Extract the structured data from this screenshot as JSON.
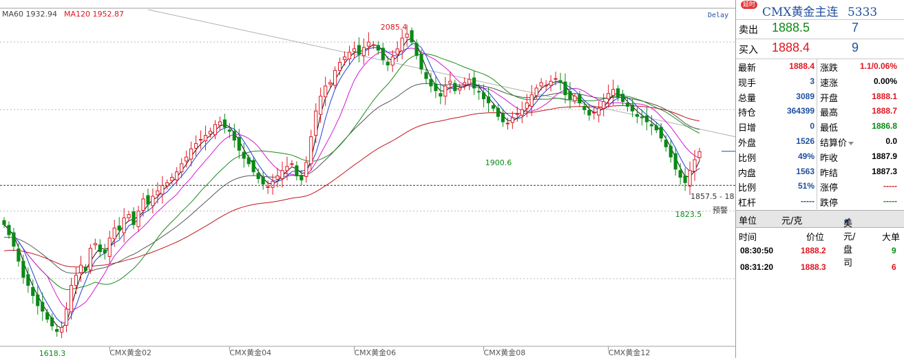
{
  "chart_data": {
    "type": "candlestick",
    "instrument": "CMX黄金主连",
    "delay_label": "Delay",
    "ma_legend": [
      {
        "name": "MA60",
        "value": "1932.94",
        "color": "#444444"
      },
      {
        "name": "MA120",
        "value": "1952.87",
        "color": "#e0141e"
      }
    ],
    "x_tick_labels": [
      "CMX黄金02",
      "CMX黄金04",
      "CMX黄金06",
      "CMX黄金08",
      "CMX黄金12"
    ],
    "annotations": {
      "high": "2085.4",
      "low": "1618.3",
      "mid_low": "1900.6",
      "recent_low": "1823.5",
      "range": "1857.5 - 18",
      "warning": "预警"
    },
    "ylim": [
      1600,
      2100
    ],
    "warning_level": 1838,
    "last_price_level": 1888.4,
    "closes": [
      1780,
      1765,
      1748,
      1726,
      1702,
      1690,
      1675,
      1660,
      1652,
      1640,
      1630,
      1622,
      1628,
      1655,
      1690,
      1705,
      1720,
      1712,
      1745,
      1752,
      1740,
      1738,
      1760,
      1775,
      1772,
      1790,
      1795,
      1780,
      1800,
      1818,
      1810,
      1822,
      1830,
      1838,
      1842,
      1850,
      1858,
      1870,
      1880,
      1892,
      1900,
      1906,
      1912,
      1918,
      1928,
      1932,
      1924,
      1918,
      1905,
      1890,
      1878,
      1870,
      1858,
      1848,
      1840,
      1836,
      1844,
      1852,
      1860,
      1866,
      1870,
      1852,
      1846,
      1872,
      1910,
      1948,
      1970,
      1985,
      1990,
      2008,
      2020,
      2028,
      2035,
      2040,
      2032,
      2042,
      2050,
      2046,
      2038,
      2024,
      2016,
      2028,
      2040,
      2056,
      2062,
      2050,
      2030,
      2010,
      1996,
      1985,
      1978,
      1970,
      1985,
      1992,
      1978,
      1982,
      1990,
      1995,
      1982,
      1976,
      1966,
      1960,
      1952,
      1940,
      1932,
      1930,
      1938,
      1944,
      1950,
      1960,
      1972,
      1982,
      1990,
      1986,
      1992,
      1996,
      1990,
      1972,
      1965,
      1970,
      1960,
      1950,
      1942,
      1946,
      1952,
      1962,
      1974,
      1980,
      1968,
      1962,
      1955,
      1948,
      1940,
      1938,
      1932,
      1926,
      1920,
      1908,
      1895,
      1880,
      1862,
      1850,
      1842,
      1860,
      1876,
      1888
    ]
  },
  "panel": {
    "delay_badge": "延时",
    "title": "CMX黄金主连",
    "code": "5333",
    "ask_label": "卖出",
    "ask_price": "1888.5",
    "ask_vol": "7",
    "bid_label": "买入",
    "bid_price": "1888.4",
    "bid_vol": "9",
    "stats_left": [
      {
        "label": "最新",
        "value": "1888.4",
        "color": "red"
      },
      {
        "label": "现手",
        "value": "3",
        "color": "blue"
      },
      {
        "label": "总量",
        "value": "3089",
        "color": "blue"
      },
      {
        "label": "持仓",
        "value": "364399",
        "color": "blue"
      },
      {
        "label": "日增",
        "value": "0",
        "color": "blue"
      },
      {
        "label": "外盘",
        "value": "1526",
        "color": "blue"
      },
      {
        "label": "比例",
        "value": "49%",
        "color": "blue"
      },
      {
        "label": "内盘",
        "value": "1563",
        "color": "blue"
      },
      {
        "label": "比例",
        "value": "51%",
        "color": "blue"
      },
      {
        "label": "杠杆",
        "value": "-----",
        "color": "blue"
      }
    ],
    "stats_right": [
      {
        "label": "涨跌",
        "value": "1.1/0.06%",
        "color": "red"
      },
      {
        "label": "速涨",
        "value": "0.00%",
        "color": "black"
      },
      {
        "label": "开盘",
        "value": "1888.1",
        "color": "red"
      },
      {
        "label": "最高",
        "value": "1888.7",
        "color": "red"
      },
      {
        "label": "最低",
        "value": "1886.8",
        "color": "green"
      },
      {
        "label": "结算价",
        "value": "0.0",
        "color": "black"
      },
      {
        "label": "昨收",
        "value": "1887.9",
        "color": "black"
      },
      {
        "label": "昨结",
        "value": "1887.3",
        "color": "black"
      },
      {
        "label": "涨停",
        "value": "-----",
        "color": "red"
      },
      {
        "label": "跌停",
        "value": "-----",
        "color": "green"
      }
    ],
    "unit_label": "单位",
    "unit_value": "元/克",
    "currency_option": "美元/盘司",
    "trade_headers": {
      "time": "时间",
      "price": "价位",
      "size": "大单"
    },
    "trades": [
      {
        "time": "08:30:50",
        "price": "1888.2",
        "size": "9",
        "size_color": "green"
      },
      {
        "time": "08:31:20",
        "price": "1888.3",
        "size": "6",
        "size_color": "red"
      }
    ]
  }
}
